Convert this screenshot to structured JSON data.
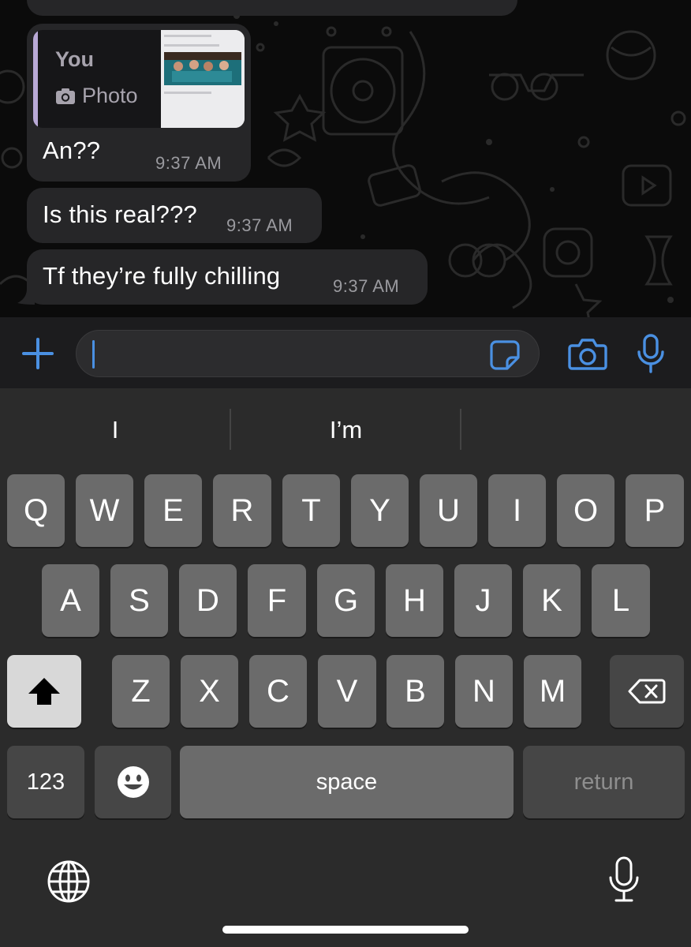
{
  "colors": {
    "accent": "#4a90e2",
    "bubble": "#262628",
    "keyboard": "#2b2b2b"
  },
  "messages": [
    {
      "reply_to": {
        "sender": "You",
        "type_label": "Photo",
        "icon": "camera-icon"
      },
      "text": "An??",
      "time": "9:37 AM"
    },
    {
      "text": "Is this real???",
      "time": "9:37 AM"
    },
    {
      "text": "Tf they’re fully chilling",
      "time": "9:37 AM"
    }
  ],
  "input": {
    "plus_icon": "plus-icon",
    "value": "",
    "sticker_icon": "sticker-icon",
    "camera_icon": "camera-icon",
    "mic_icon": "microphone-icon"
  },
  "keyboard": {
    "suggestions": [
      "I",
      "I’m"
    ],
    "rows": [
      [
        "Q",
        "W",
        "E",
        "R",
        "T",
        "Y",
        "U",
        "I",
        "O",
        "P"
      ],
      [
        "A",
        "S",
        "D",
        "F",
        "G",
        "H",
        "J",
        "K",
        "L"
      ],
      [
        "Z",
        "X",
        "C",
        "V",
        "B",
        "N",
        "M"
      ]
    ],
    "numbers_label": "123",
    "space_label": "space",
    "return_label": "return",
    "shift_icon": "shift-icon",
    "delete_icon": "delete-icon",
    "emoji_icon": "emoji-icon",
    "globe_icon": "globe-icon",
    "dictation_icon": "microphone-icon"
  }
}
